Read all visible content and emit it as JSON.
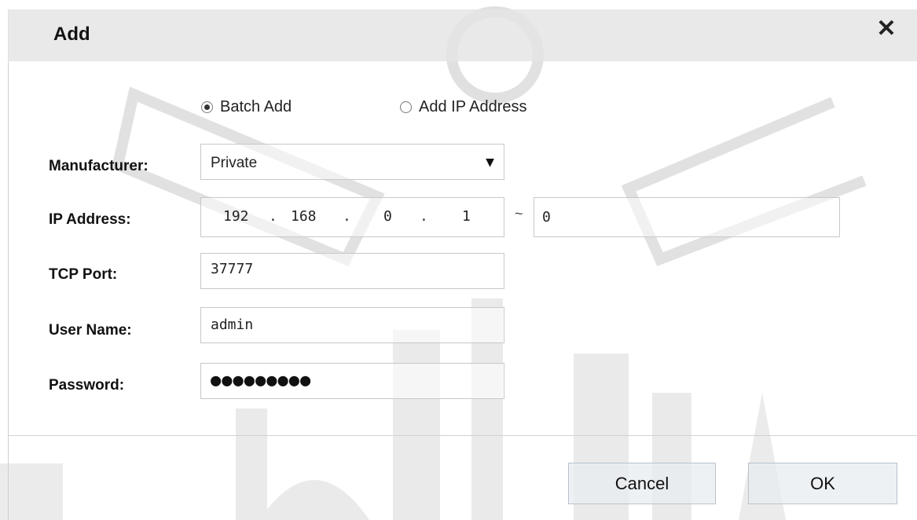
{
  "dialog": {
    "title": "Add",
    "close_icon": "close-icon",
    "close_glyph": "✕"
  },
  "mode": {
    "batch_label": "Batch Add",
    "ip_label": "Add IP Address",
    "selected": "Batch Add"
  },
  "form": {
    "manufacturer_label": "Manufacturer:",
    "manufacturer_value": "Private",
    "ip_label": "IP Address:",
    "ip_octets": [
      "192",
      "168",
      "0",
      "1"
    ],
    "ip_dot": ".",
    "ip_range_sep": "~",
    "ip_end": "0",
    "tcp_label": "TCP Port:",
    "tcp_value": "37777",
    "user_label": "User Name:",
    "user_value": "admin",
    "password_label": "Password:",
    "password_mask": "●●●●●●●●●"
  },
  "buttons": {
    "cancel": "Cancel",
    "ok": "OK"
  },
  "colors": {
    "titlebar": "#e4e4e4",
    "field_border": "#c8c8c8",
    "button_bg": "#e8ecf0"
  }
}
